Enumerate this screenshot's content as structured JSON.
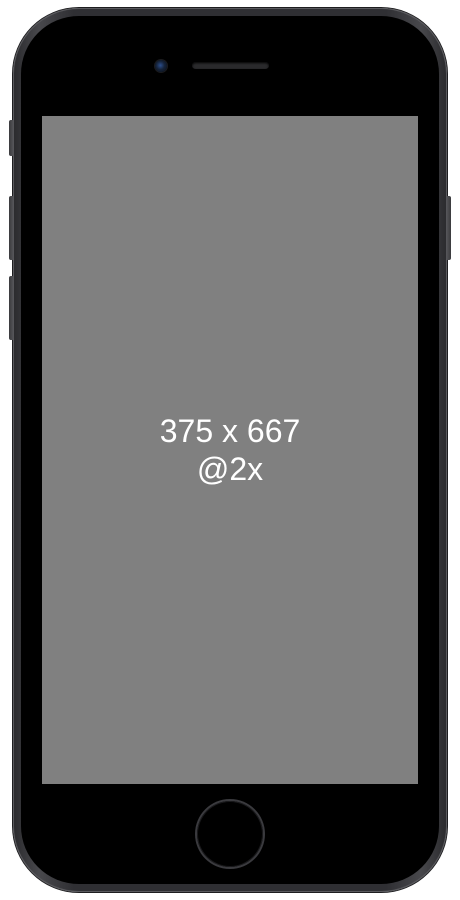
{
  "device": {
    "model": "iPhone",
    "color": "space-gray"
  },
  "screen": {
    "background": "#808080",
    "resolution_label": "375 x 667",
    "scale_label": "@2x"
  },
  "icons": {
    "camera": "front-camera-icon",
    "speaker": "earpiece-speaker-icon",
    "home": "home-button-icon"
  }
}
